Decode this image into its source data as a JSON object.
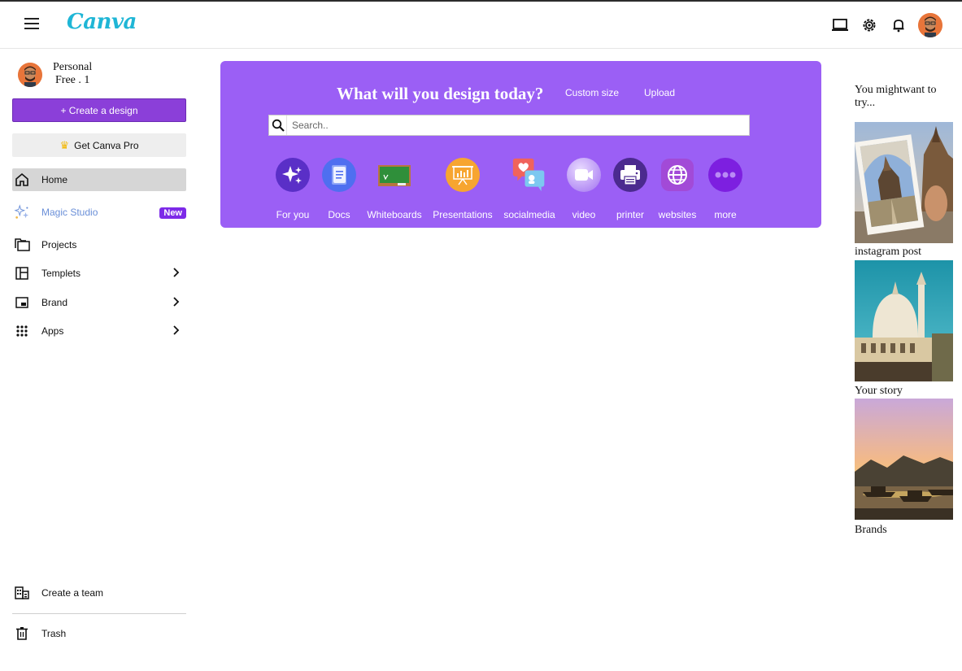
{
  "header": {
    "logo_text": "Canva",
    "icons": [
      "menu-icon",
      "laptop-icon",
      "gear-icon",
      "bell-icon",
      "user-avatar"
    ]
  },
  "sidebar": {
    "profile": {
      "name": "Personal",
      "plan": "Free . 1"
    },
    "create_button": "+ Create a design",
    "pro_button": "Get Canva Pro",
    "items": [
      {
        "label": "Home",
        "icon": "home-icon",
        "active": true
      },
      {
        "label": "Magic Studio",
        "icon": "sparkle-icon",
        "badge": "New"
      },
      {
        "label": "Projects",
        "icon": "folders-icon"
      },
      {
        "label": "Templets",
        "icon": "layout-icon",
        "chevron": true
      },
      {
        "label": "Brand",
        "icon": "brand-icon",
        "chevron": true
      },
      {
        "label": "Apps",
        "icon": "grid-icon",
        "chevron": true
      }
    ],
    "footer_items": [
      {
        "label": "Create a team",
        "icon": "building-icon"
      },
      {
        "label": "Trash",
        "icon": "trash-icon"
      }
    ]
  },
  "hero": {
    "title": "What will you design today?",
    "custom_size": "Custom size",
    "upload": "Upload",
    "search_placeholder": "Search..",
    "categories": [
      {
        "label": "For you",
        "icon": "sparkle-icon",
        "color": "#5a2fc7"
      },
      {
        "label": "Docs",
        "icon": "document-icon",
        "color": "#4f6ff0"
      },
      {
        "label": "Whiteboards",
        "icon": "whiteboard-icon",
        "color": "#2f8f3a"
      },
      {
        "label": "Presentations",
        "icon": "presentation-icon",
        "color": "#f7a530"
      },
      {
        "label": "socialmedia",
        "icon": "social-media-icon",
        "color": "#f0635c"
      },
      {
        "label": "video",
        "icon": "video-icon",
        "color": "#b48cf7"
      },
      {
        "label": "printer",
        "icon": "printer-icon",
        "color": "#4b2a8f"
      },
      {
        "label": "websites",
        "icon": "website-icon",
        "color": "#a24ad7"
      },
      {
        "label": "more",
        "icon": "more-icon",
        "color": "#7d1fe0"
      }
    ]
  },
  "suggestions": {
    "title": "You mightwant to try...",
    "items": [
      {
        "label": "instagram post",
        "icon": "temple-photo"
      },
      {
        "label": "Your story",
        "icon": "mosque-photo"
      },
      {
        "label": "Brands",
        "icon": "lake-sunset-photo"
      }
    ]
  },
  "colors": {
    "accent": "#8b3fd9",
    "hero_bg": "#9b5ff5",
    "logo": "#1fb6d6",
    "badge": "#7d2ae8"
  }
}
